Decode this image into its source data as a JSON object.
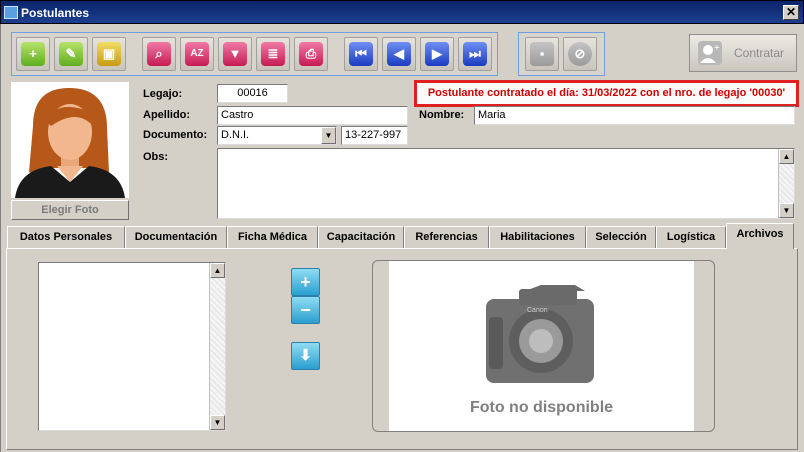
{
  "window": {
    "title": "Postulantes",
    "close_label": "✕"
  },
  "toolbar": {
    "buttons": [
      {
        "name": "add",
        "glyph": "+"
      },
      {
        "name": "edit",
        "glyph": "✎"
      },
      {
        "name": "delete",
        "glyph": "▣"
      },
      {
        "name": "search",
        "glyph": "⌕"
      },
      {
        "name": "sort",
        "glyph": "AZ"
      },
      {
        "name": "filter",
        "glyph": "▼"
      },
      {
        "name": "report",
        "glyph": "≣"
      },
      {
        "name": "print",
        "glyph": "⎙"
      },
      {
        "name": "first",
        "glyph": "⏮"
      },
      {
        "name": "prev",
        "glyph": "◀"
      },
      {
        "name": "next",
        "glyph": "▶"
      },
      {
        "name": "last",
        "glyph": "⏭"
      },
      {
        "name": "save",
        "glyph": "▪"
      },
      {
        "name": "cancel",
        "glyph": "⊘"
      }
    ],
    "contratar_label": "Contratar"
  },
  "photo": {
    "elegir_label": "Elegir Foto"
  },
  "form": {
    "legajo_label": "Legajo:",
    "legajo_value": "00016",
    "apellido_label": "Apellido:",
    "apellido_value": "Castro",
    "nombre_label": "Nombre:",
    "nombre_value": "Maria",
    "documento_label": "Documento:",
    "documento_tipo": "D.N.I.",
    "documento_numero": "13-227-997",
    "obs_label": "Obs:",
    "obs_value": ""
  },
  "warning": "Postulante contratado el día: 31/03/2022 con el nro. de legajo '00030'",
  "tabs": [
    "Datos Personales",
    "Documentación",
    "Ficha Médica",
    "Capacitación",
    "Referencias",
    "Habilitaciones",
    "Selección",
    "Logística",
    "Archivos"
  ],
  "active_tab": "Archivos",
  "archivos": {
    "no_photo_label": "Foto no disponible",
    "camera_brand": "Canon",
    "add_glyph": "+",
    "remove_glyph": "−",
    "download_glyph": "⬇"
  },
  "colors": {
    "accent": "#0a246a",
    "warning": "#e02020",
    "toolbar_border": "#6fa0e0"
  }
}
